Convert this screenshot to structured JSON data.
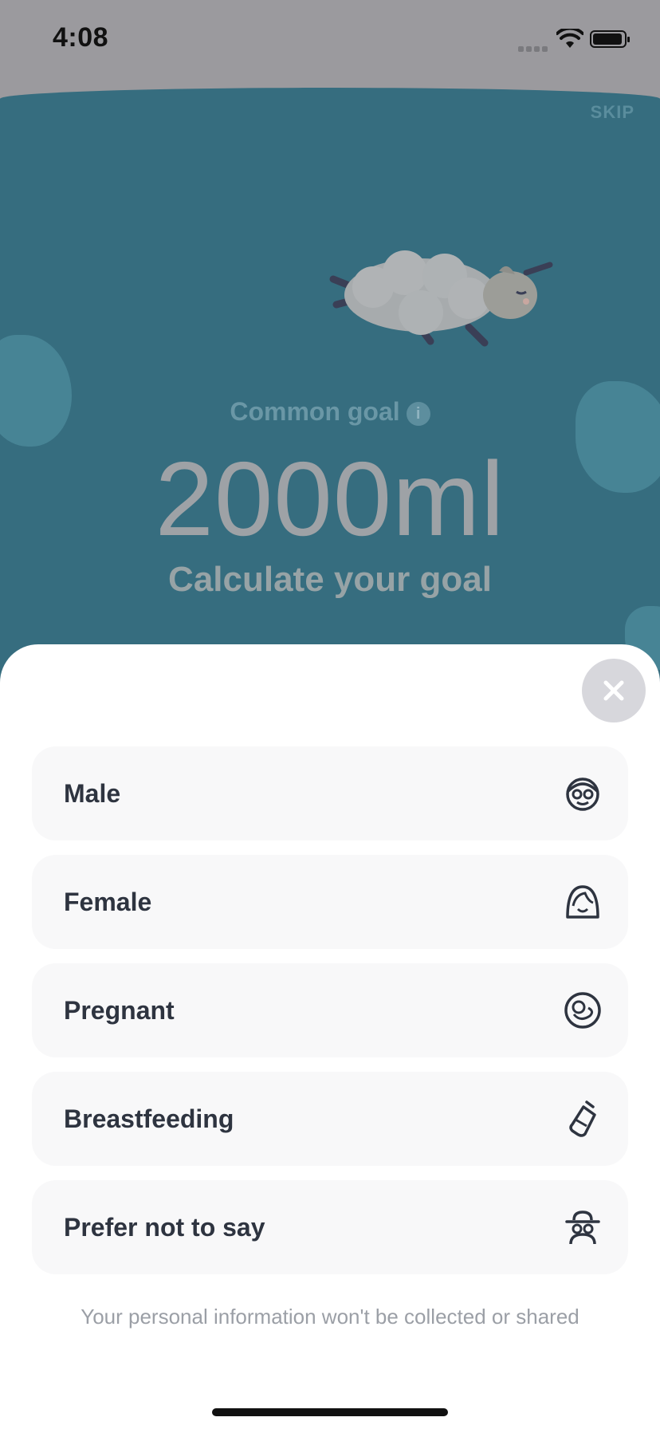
{
  "status": {
    "time": "4:08"
  },
  "hero": {
    "skip_label": "SKIP",
    "goal_label": "Common goal",
    "goal_value": "2000ml",
    "goal_sub": "Calculate your goal"
  },
  "sheet": {
    "options": [
      {
        "label": "Male",
        "icon": "male-face-icon"
      },
      {
        "label": "Female",
        "icon": "female-face-icon"
      },
      {
        "label": "Pregnant",
        "icon": "pregnant-icon"
      },
      {
        "label": "Breastfeeding",
        "icon": "baby-bottle-icon"
      },
      {
        "label": "Prefer not to say",
        "icon": "incognito-icon"
      }
    ],
    "note": "Your personal information won't be collected or shared"
  },
  "colors": {
    "backdrop": "#366d7f",
    "sheet": "#ffffff",
    "option_bg": "#f8f8f9",
    "text": "#2e3440"
  }
}
